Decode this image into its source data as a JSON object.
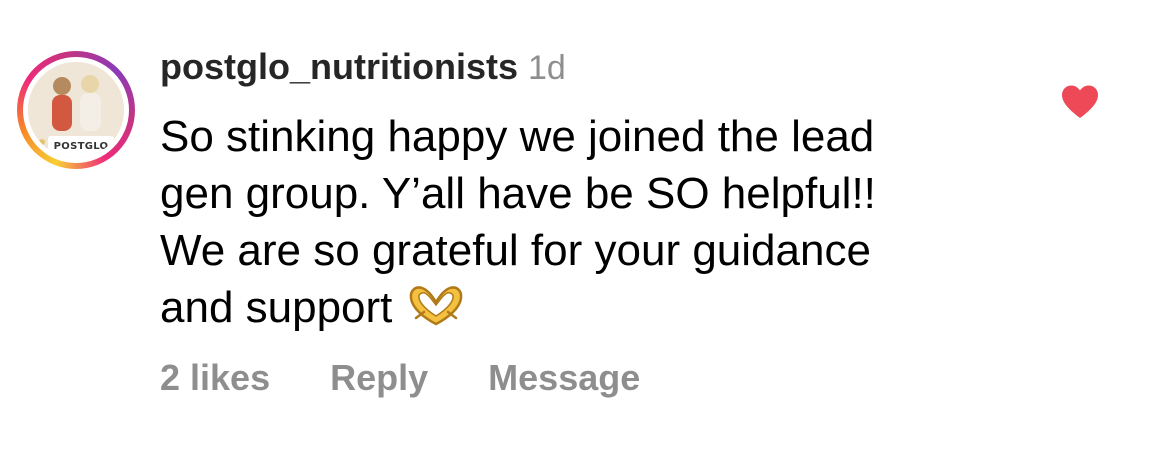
{
  "comment": {
    "username": "postglo_nutritionists",
    "timestamp": "1d",
    "avatar_badge": "POSTGLO",
    "text_lines": [
      "So stinking happy we joined the lead",
      "gen group. Y’all have be SO helpful!!",
      "We are so grateful for your guidance",
      "and support"
    ],
    "emoji_icon": "heart-hands-emoji",
    "like_icon": "heart-filled-icon"
  },
  "actions": {
    "likes_label": "2 likes",
    "reply_label": "Reply",
    "message_label": "Message"
  },
  "colors": {
    "like_heart": "#ed4956",
    "secondary_text": "#8e8e8e",
    "username": "#262626"
  }
}
